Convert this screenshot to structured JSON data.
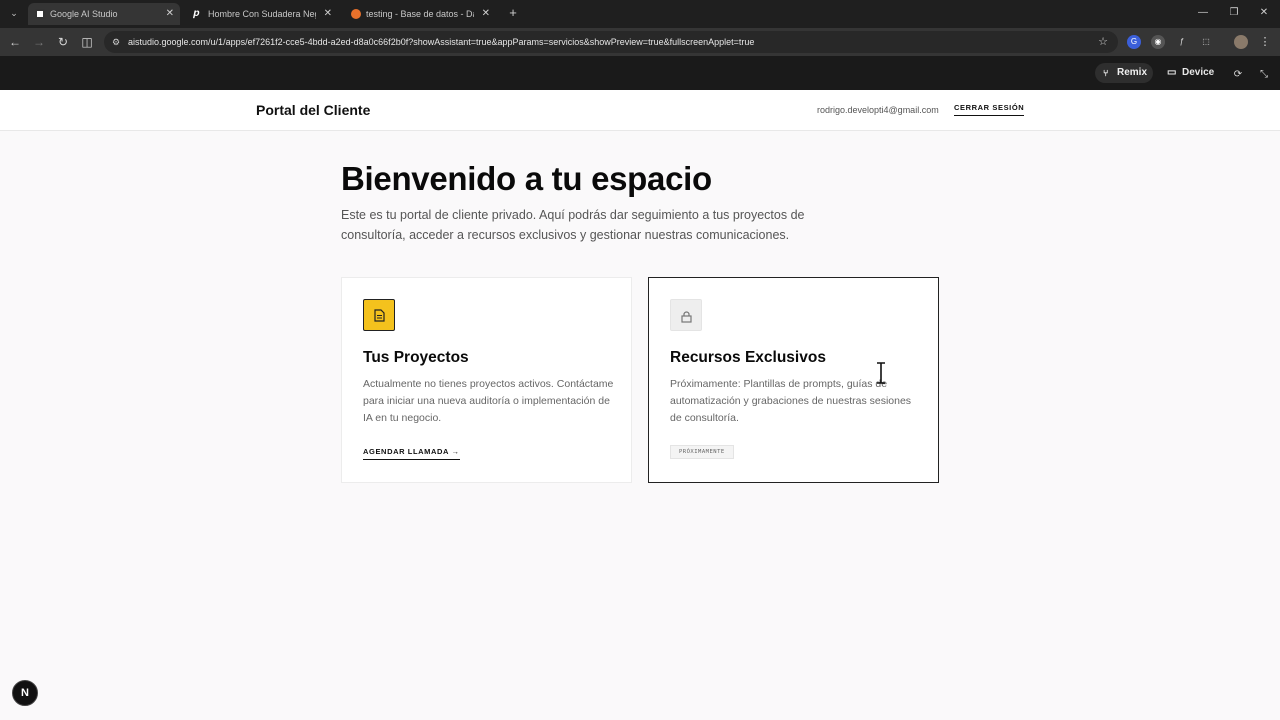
{
  "browser": {
    "tabs": [
      {
        "label": "Google AI Studio",
        "active": true,
        "close": "✕"
      },
      {
        "label": "Hombre Con Sudadera Negra",
        "active": false,
        "close": "✕"
      },
      {
        "label": "testing - Base de datos - Datos",
        "active": false,
        "close": "✕"
      }
    ],
    "new_tab": "+",
    "url": "aistudio.google.com/u/1/apps/ef7261f2-cce5-4bdd-a2ed-d8a0c66f2b0f?showAssistant=true&appParams=servicios&showPreview=true&fullscreenApplet=true"
  },
  "appbar": {
    "remix_label": "Remix",
    "device_label": "Device"
  },
  "header": {
    "brand": "Portal del Cliente",
    "user_email": "rodrigo.developti4@gmail.com",
    "logout_label": "CERRAR SESIÓN"
  },
  "hero": {
    "title": "Bienvenido a tu espacio",
    "description": "Este es tu portal de cliente privado. Aquí podrás dar seguimiento a tus proyectos de consultoría, acceder a recursos exclusivos y gestionar nuestras comunicaciones."
  },
  "cards": [
    {
      "title": "Tus Proyectos",
      "text": "Actualmente no tienes proyectos activos. Contáctame para iniciar una nueva auditoría o implementación de IA en tu negocio.",
      "link_label": "AGENDAR LLAMADA →",
      "icon": "document-icon"
    },
    {
      "title": "Recursos Exclusivos",
      "text": "Próximamente: Plantillas de prompts, guías de automatización y grabaciones de nuestras sesiones de consultoría.",
      "badge": "PRÓXIMAMENTE",
      "icon": "lock-icon"
    }
  ],
  "dev_badge": "N",
  "colors": {
    "accent": "#f4c21d",
    "page_bg": "#faf9fa",
    "text_primary": "#0a0a0a",
    "text_muted": "#555555"
  }
}
